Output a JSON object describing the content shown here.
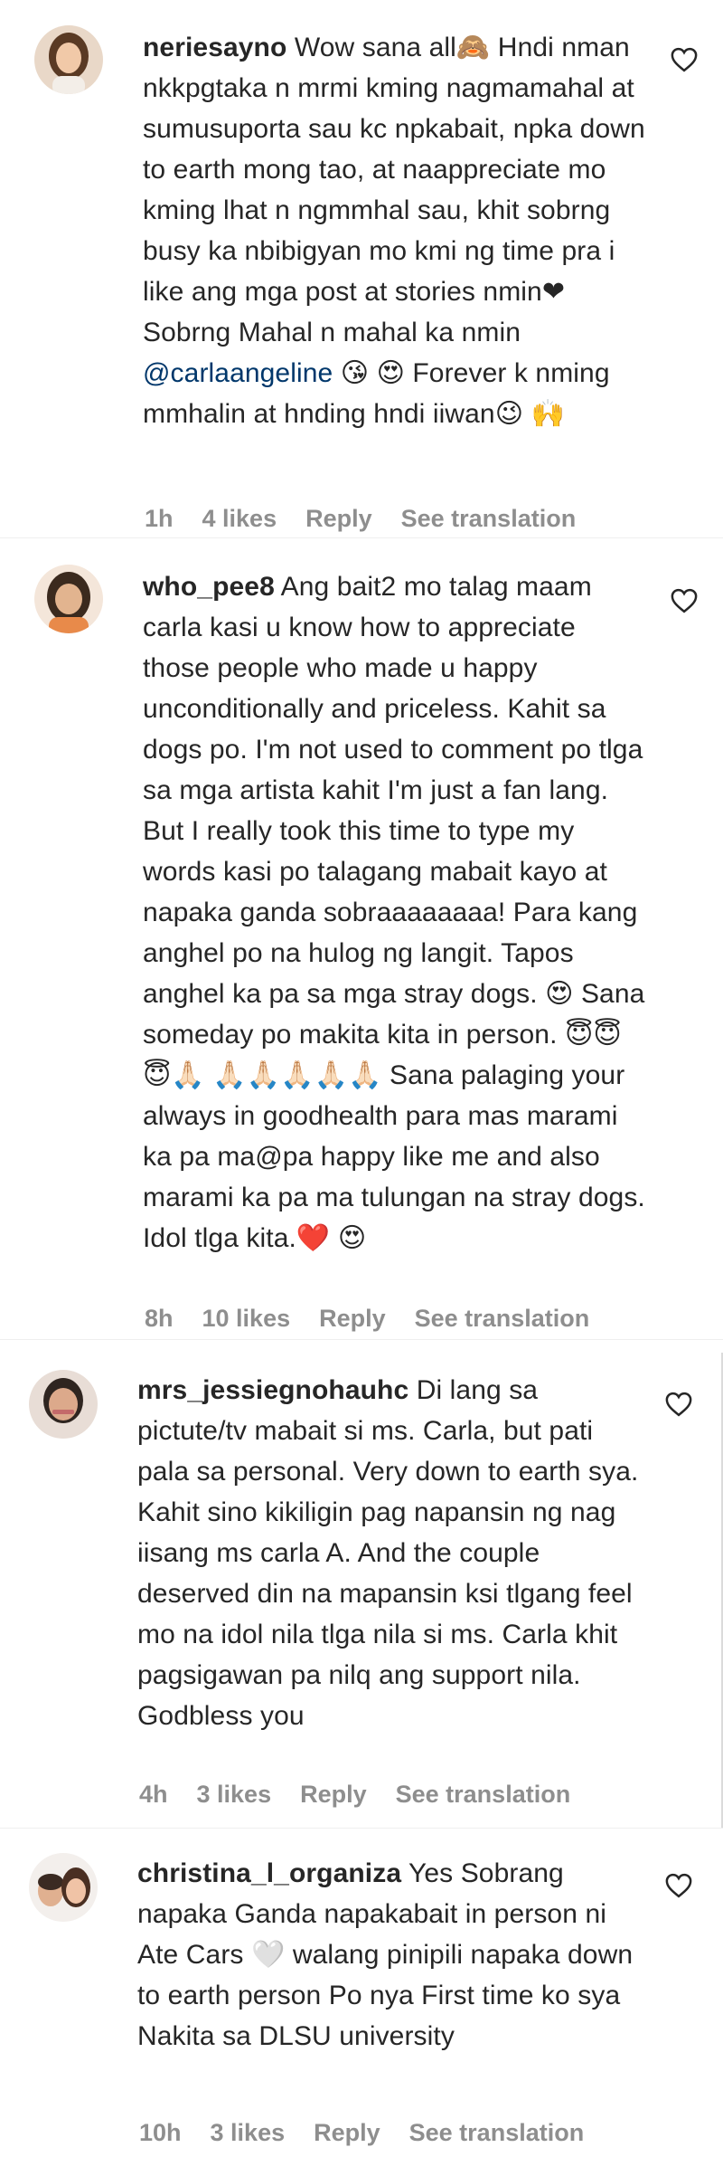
{
  "comments": [
    {
      "username": "neriesayno",
      "text_before_mention": "Wow sana all🙈 Hndi nman nkkpgtaka n mrmi kming nagmamahal at sumusuporta sau kc npkabait, npka down to earth mong tao, at naappreciate mo kming lhat n ngmmhal sau, khit sobrng busy ka nbibigyan mo kmi ng time pra i like ang mga post at stories nmin❤ Sobrng Mahal n mahal ka nmin ",
      "mention": "@carlaangeline",
      "text_after_mention": " 😘 😍 Forever k nming mmhalin at hnding hndi iiwan😉 🙌",
      "time": "1h",
      "likes": "4 likes",
      "reply": "Reply",
      "translate": "See translation"
    },
    {
      "username": "who_pee8",
      "text": "Ang bait2 mo talag maam carla kasi u know how to appreciate those people who made u happy unconditionally and priceless. Kahit sa dogs po. I'm not used to comment po tlga sa mga artista kahit I'm just a fan lang. But I really took this time to type my words kasi po talagang mabait kayo at napaka ganda sobraaaaaaaa! Para kang anghel po na hulog ng langit. Tapos anghel ka pa sa mga stray dogs. 😍 Sana someday po makita kita in person. 😇😇😇🙏🏻 🙏🏻🙏🏻🙏🏻🙏🏻🙏🏻 Sana palaging your always in goodhealth para mas marami ka pa ma@pa happy like me and also marami ka pa ma tulungan na stray dogs. Idol tlga kita.❤️ 😍",
      "time": "8h",
      "likes": "10 likes",
      "reply": "Reply",
      "translate": "See translation"
    },
    {
      "username": "mrs_jessiegnohauhc",
      "text": "Di lang sa pictute/tv mabait si ms. Carla, but pati pala sa personal. Very down to earth sya. Kahit sino kikiligin pag napansin ng nag iisang ms carla A. And the couple deserved din na mapansin ksi tlgang feel mo na idol nila tlga nila si ms. Carla khit pagsigawan pa nilq ang support nila. Godbless you",
      "time": "4h",
      "likes": "3 likes",
      "reply": "Reply",
      "translate": "See translation"
    },
    {
      "username": "christina_l_organiza",
      "text": "Yes Sobrang napaka Ganda napakabait in person ni Ate Cars 🤍 walang pinipili napaka down to earth person Po nya First time ko sya Nakita sa DLSU university",
      "time": "10h",
      "likes": "3 likes",
      "reply": "Reply",
      "translate": "See translation"
    }
  ],
  "colors": {
    "text": "#262626",
    "muted": "#8e8e8e",
    "mention": "#00376b",
    "divider": "#efefef"
  },
  "icons": {
    "like": "heart-outline-icon"
  }
}
